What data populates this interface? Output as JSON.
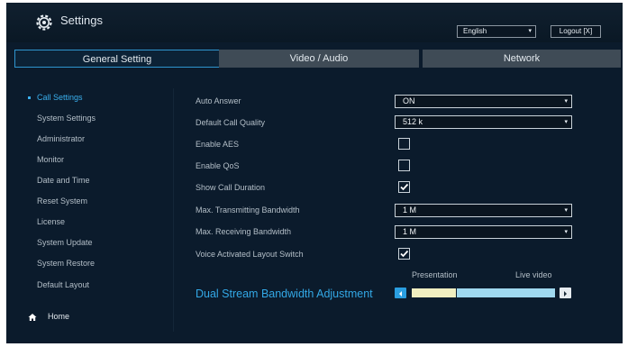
{
  "app": {
    "title": "Settings"
  },
  "header": {
    "language": "English",
    "logout_label": "Logout [X]"
  },
  "tabs": [
    {
      "label": "General Setting",
      "active": true
    },
    {
      "label": "Video / Audio",
      "active": false
    },
    {
      "label": "Network",
      "active": false
    }
  ],
  "sidebar": {
    "items": [
      {
        "label": "Call Settings",
        "active": true
      },
      {
        "label": "System Settings"
      },
      {
        "label": "Administrator"
      },
      {
        "label": "Monitor"
      },
      {
        "label": "Date and Time"
      },
      {
        "label": "Reset System"
      },
      {
        "label": "License"
      },
      {
        "label": "System Update"
      },
      {
        "label": "System Restore"
      },
      {
        "label": "Default Layout"
      }
    ],
    "home_label": "Home"
  },
  "settings": {
    "auto_answer": {
      "label": "Auto Answer",
      "value": "ON"
    },
    "default_call_quality": {
      "label": "Default Call Quality",
      "value": "512 k"
    },
    "enable_aes": {
      "label": "Enable AES",
      "checked": false
    },
    "enable_qos": {
      "label": "Enable QoS",
      "checked": false
    },
    "show_call_duration": {
      "label": "Show Call Duration",
      "checked": true
    },
    "max_tx_bandwidth": {
      "label": "Max. Transmitting Bandwidth",
      "value": "1 M"
    },
    "max_rx_bandwidth": {
      "label": "Max. Receiving Bandwidth",
      "value": "1 M"
    },
    "voice_activated_layout_switch": {
      "label": "Voice Activated Layout Switch",
      "checked": true
    }
  },
  "dual_stream": {
    "label": "Dual Stream Bandwidth Adjustment",
    "presentation_label": "Presentation",
    "live_video_label": "Live video",
    "presentation_fraction": 0.31
  },
  "colors": {
    "accent": "#33a8e6",
    "background": "#0b1b2c",
    "presentation_bar": "#f0eec0",
    "live_video_bar": "#9fd8ef"
  },
  "icons": {
    "logo": "gear-icon",
    "home": "home-icon",
    "check": "check-icon",
    "caret": "chevron-down-icon",
    "left_arrow": "arrow-left-icon",
    "right_arrow": "arrow-right-icon"
  }
}
